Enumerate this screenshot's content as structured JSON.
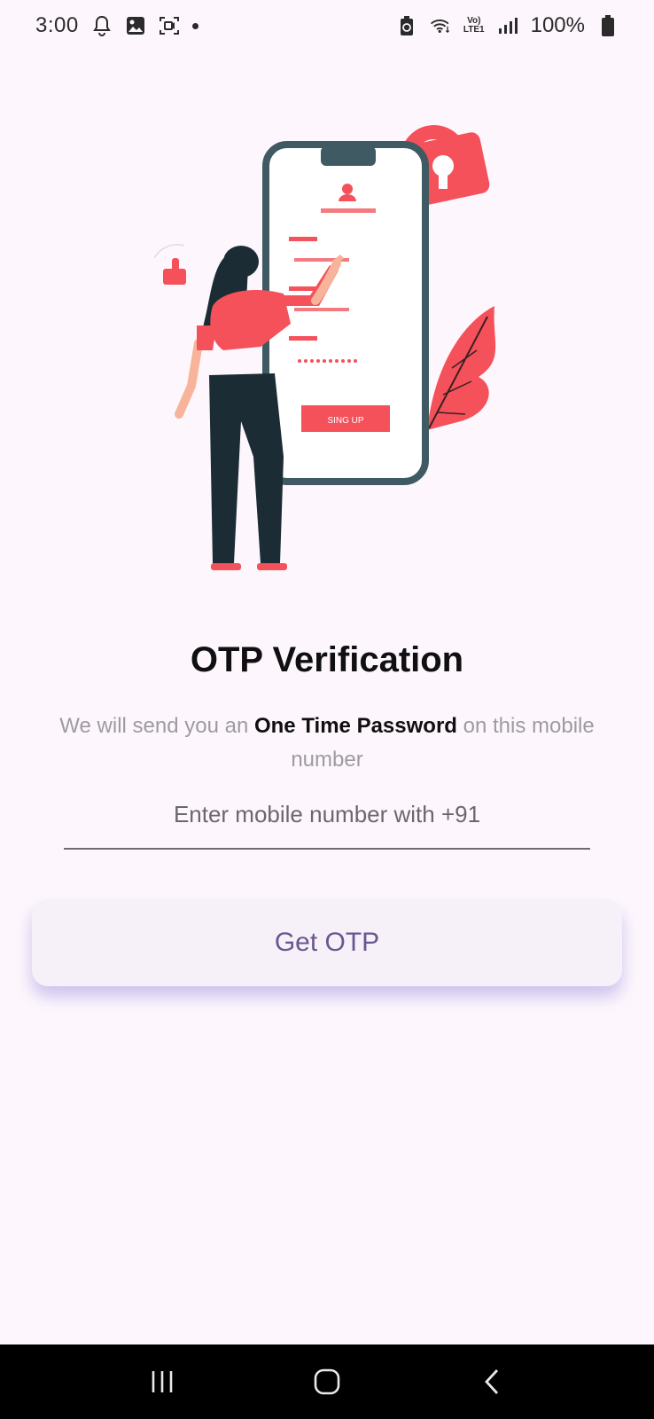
{
  "status_bar": {
    "time": "3:00",
    "battery": "100%",
    "volte_top": "Vo)",
    "volte_bottom": "LTE1",
    "icons": [
      "bell-icon",
      "image-icon",
      "screen-record-icon",
      "dot",
      "battery-saver-icon",
      "wifi-icon",
      "volte-icon",
      "signal-icon",
      "battery-icon"
    ]
  },
  "illustration": {
    "button_label": "SING UP"
  },
  "title": "OTP Verification",
  "subtitle": {
    "before": "We will send you an ",
    "emphasis": "One Time Password",
    "after": " on this mobile number"
  },
  "phone_input": {
    "placeholder": "Enter mobile number with +91",
    "value": ""
  },
  "otp_button": {
    "label": "Get OTP"
  },
  "nav_bar": {
    "icons": [
      "recent-apps-icon",
      "home-icon",
      "back-icon"
    ]
  },
  "colors": {
    "background": "#fdf7fd",
    "accent_red": "#f4515b",
    "phone_frame": "#3f5a62",
    "button_text": "#6a5690"
  }
}
